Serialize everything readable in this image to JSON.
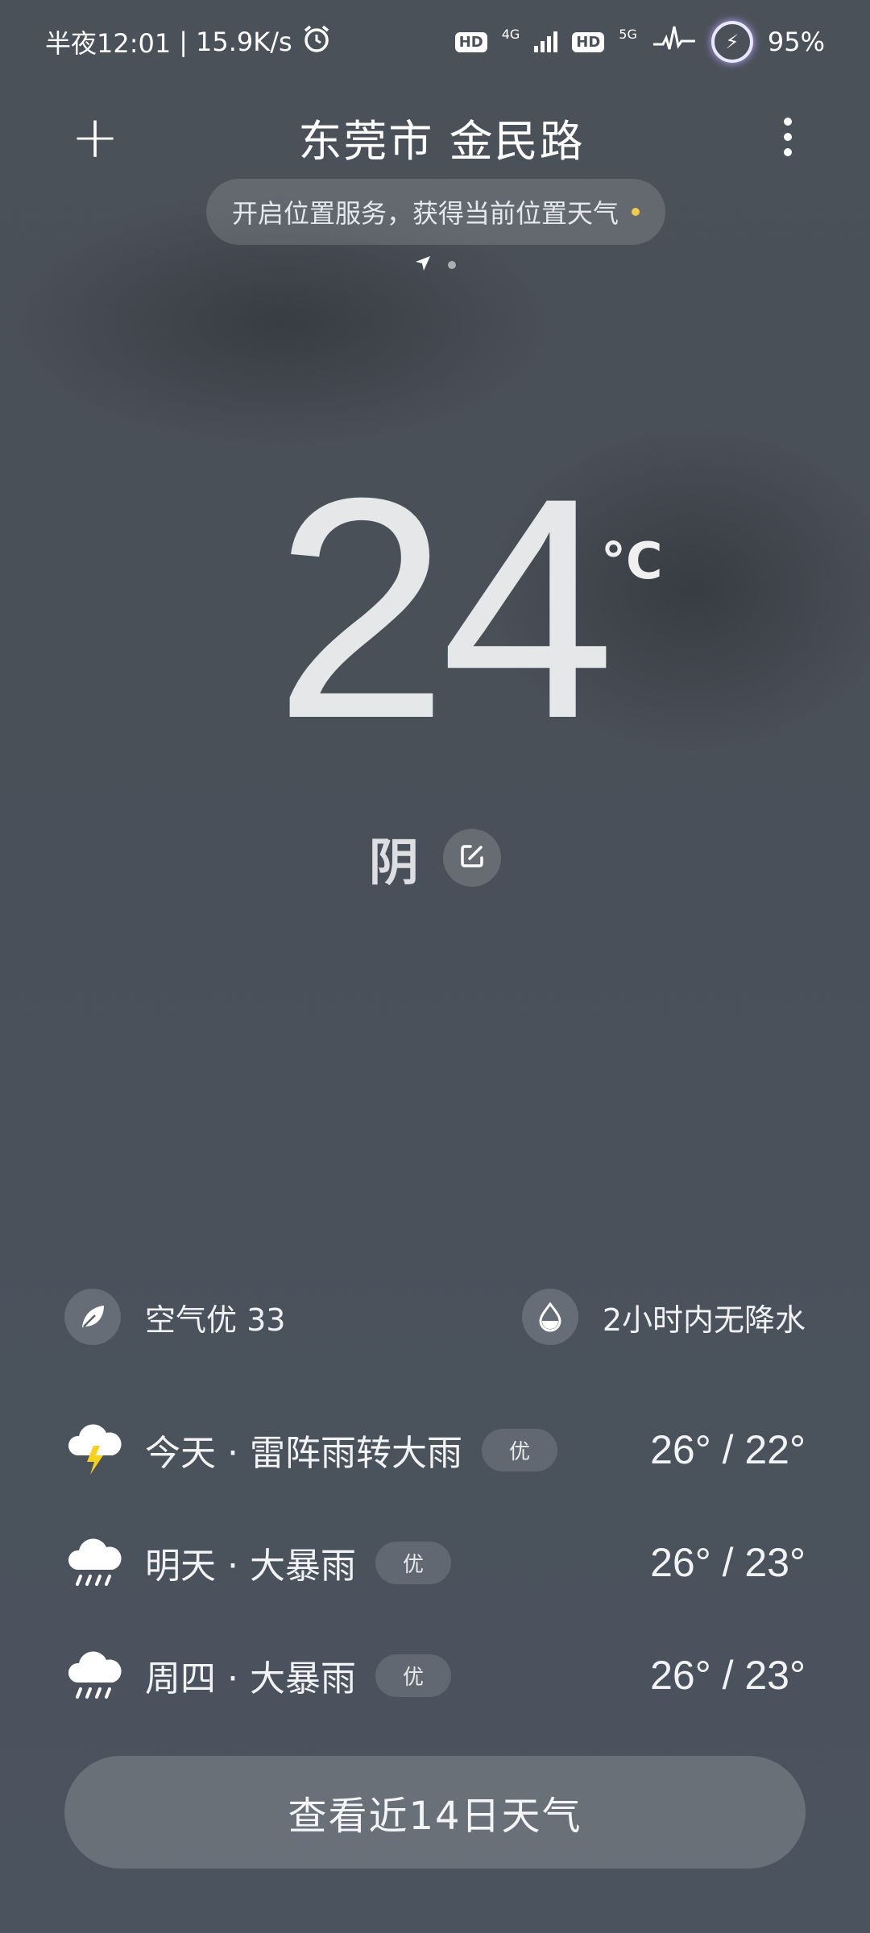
{
  "status_bar": {
    "time": "半夜12:01",
    "separator": "|",
    "speed": "15.9K/s",
    "net1": "4G",
    "net2": "5G",
    "hd": "HD",
    "battery": "95%"
  },
  "header": {
    "city": "东莞市 金民路",
    "location_notice": "开启位置服务，获得当前位置天气"
  },
  "current": {
    "temperature": "24",
    "unit": "°C",
    "condition": "阴"
  },
  "info": {
    "air_quality": "空气优 33",
    "precipitation": "2小时内无降水"
  },
  "forecast": [
    {
      "label": "今天 · 雷阵雨转大雨",
      "aqi": "优",
      "temps": "26° / 22°",
      "icon": "thunderstorm-icon"
    },
    {
      "label": "明天 · 大暴雨",
      "aqi": "优",
      "temps": "26° / 23°",
      "icon": "heavy-rain-icon"
    },
    {
      "label": "周四 · 大暴雨",
      "aqi": "优",
      "temps": "26° / 23°",
      "icon": "heavy-rain-icon"
    }
  ],
  "actions": {
    "view_14_days": "查看近14日天气"
  },
  "colors": {
    "background": "#4b5159",
    "accent_yellow": "#f3c94b"
  }
}
